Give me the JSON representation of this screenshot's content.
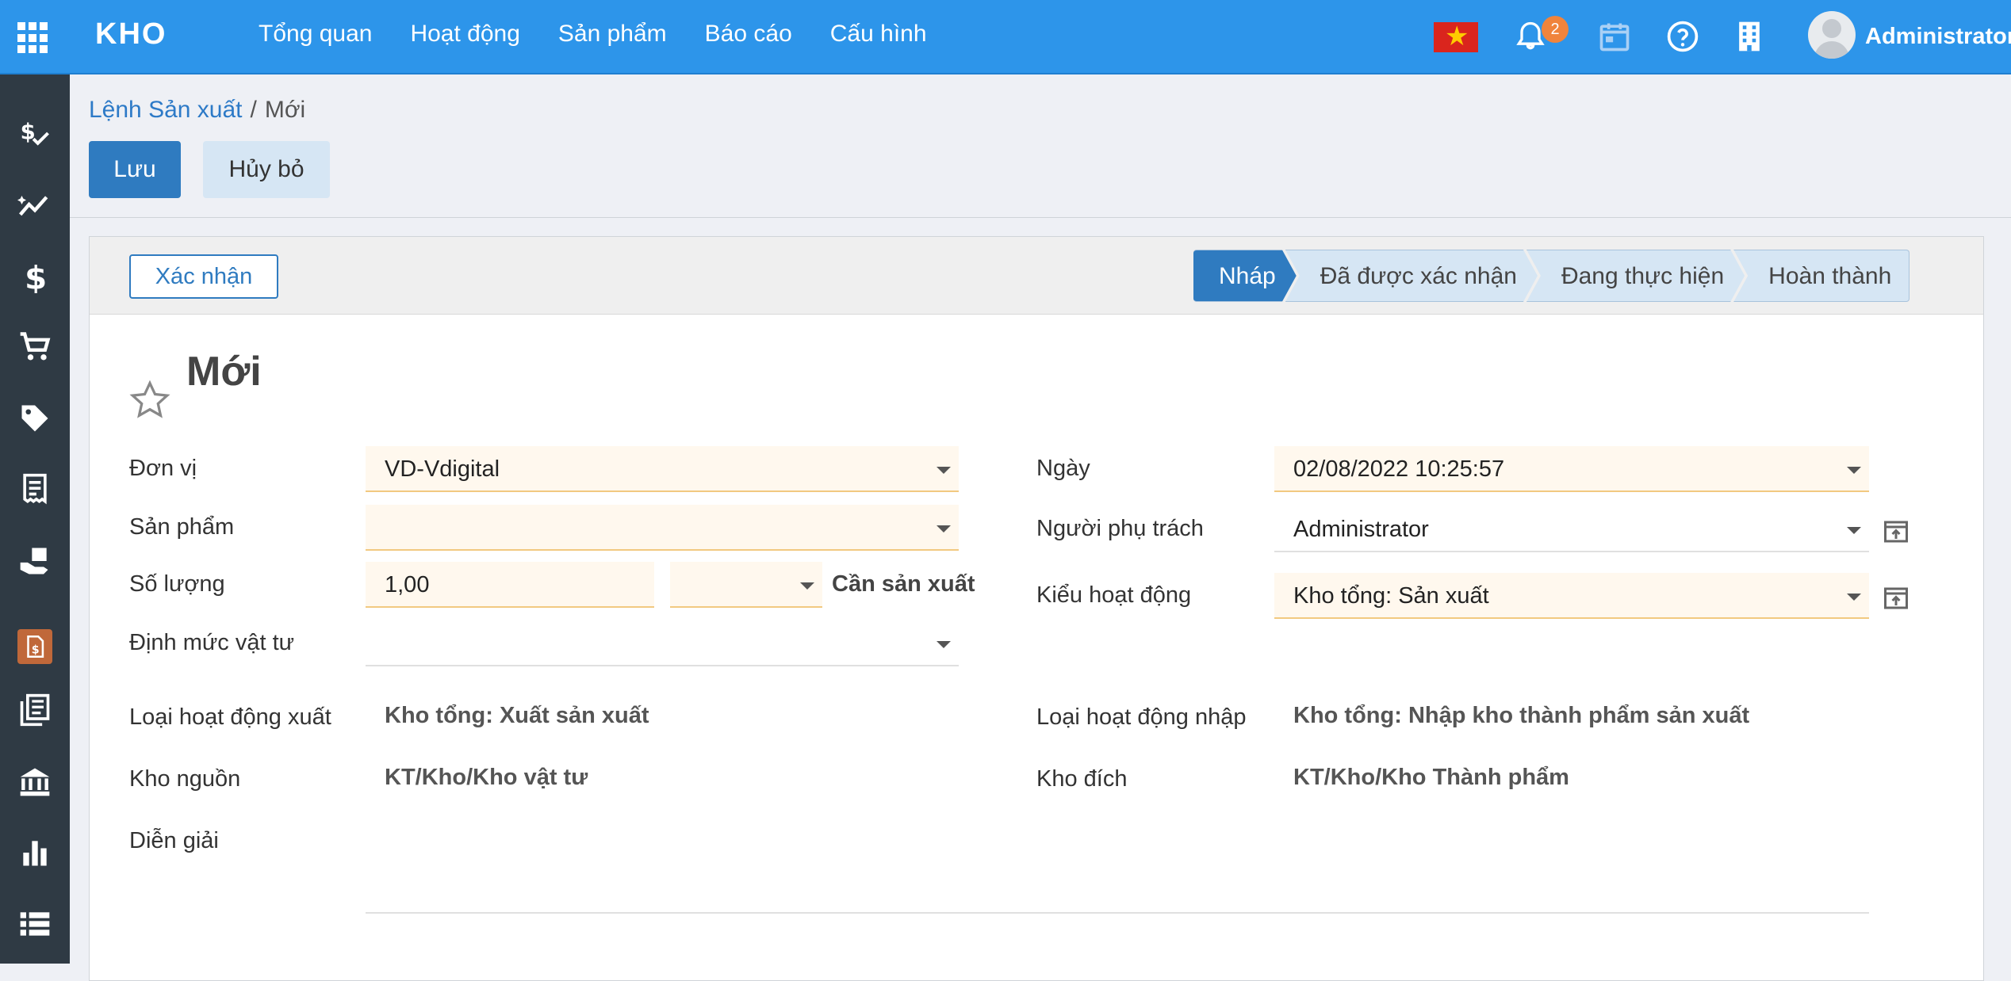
{
  "topbar": {
    "brand": "KHO",
    "menu": [
      "Tổng quan",
      "Hoạt động",
      "Sản phẩm",
      "Báo cáo",
      "Cấu hình"
    ],
    "notification_count": "2",
    "user_name": "Administrator",
    "icons": [
      "apps-icon",
      "vietnam-flag-icon",
      "bell-icon",
      "calendar-icon",
      "help-icon",
      "building-icon",
      "avatar"
    ]
  },
  "sidebar": {
    "icons": [
      "money-check-icon",
      "trend-chart-icon",
      "dollar-icon",
      "cart-icon",
      "tag-icon",
      "receipt-icon",
      "hand-box-icon",
      "invoice-icon",
      "book-icon",
      "bank-icon",
      "bar-chart-icon",
      "list-icon"
    ]
  },
  "breadcrumb": {
    "parent": "Lệnh Sản xuất",
    "separator": "/",
    "current": "Mới"
  },
  "actions": {
    "save_label": "Lưu",
    "discard_label": "Hủy bỏ"
  },
  "status": {
    "confirm_label": "Xác nhận",
    "stages": [
      "Nháp",
      "Đã được xác nhận",
      "Đang thực hiện",
      "Hoàn thành"
    ],
    "active_stage": "Nháp"
  },
  "form": {
    "title": "Mới",
    "left": {
      "don_vi_label": "Đơn vị",
      "don_vi_value": "VD-Vdigital",
      "san_pham_label": "Sản phẩm",
      "san_pham_value": "",
      "so_luong_label": "Số lượng",
      "so_luong_value": "1,00",
      "uom_value": "",
      "can_san_xuat": "Cần sản xuất",
      "dinh_muc_label": "Định mức vật tư",
      "dinh_muc_value": "",
      "loai_xuat_label": "Loại hoạt động xuất",
      "loai_xuat_value": "Kho tổng: Xuất sản xuất",
      "kho_nguon_label": "Kho nguồn",
      "kho_nguon_value": "KT/Kho/Kho vật tư",
      "dien_giai_label": "Diễn giải",
      "dien_giai_value": ""
    },
    "right": {
      "ngay_label": "Ngày",
      "ngay_value": "02/08/2022 10:25:57",
      "nguoi_phu_trach_label": "Người phụ trách",
      "nguoi_phu_trach_value": "Administrator",
      "kieu_hoat_dong_label": "Kiểu hoạt động",
      "kieu_hoat_dong_value": "Kho tổng: Sản xuất",
      "loai_nhap_label": "Loại hoạt động nhập",
      "loai_nhap_value": "Kho tổng: Nhập kho thành phẩm sản xuất",
      "kho_dich_label": "Kho đích",
      "kho_dich_value": "KT/Kho/Kho Thành phẩm"
    }
  },
  "colors": {
    "topbar": "#2d95ea",
    "sidebar": "#2f3a44",
    "primary": "#2f7bc0",
    "required_bg": "#fff8ee"
  }
}
